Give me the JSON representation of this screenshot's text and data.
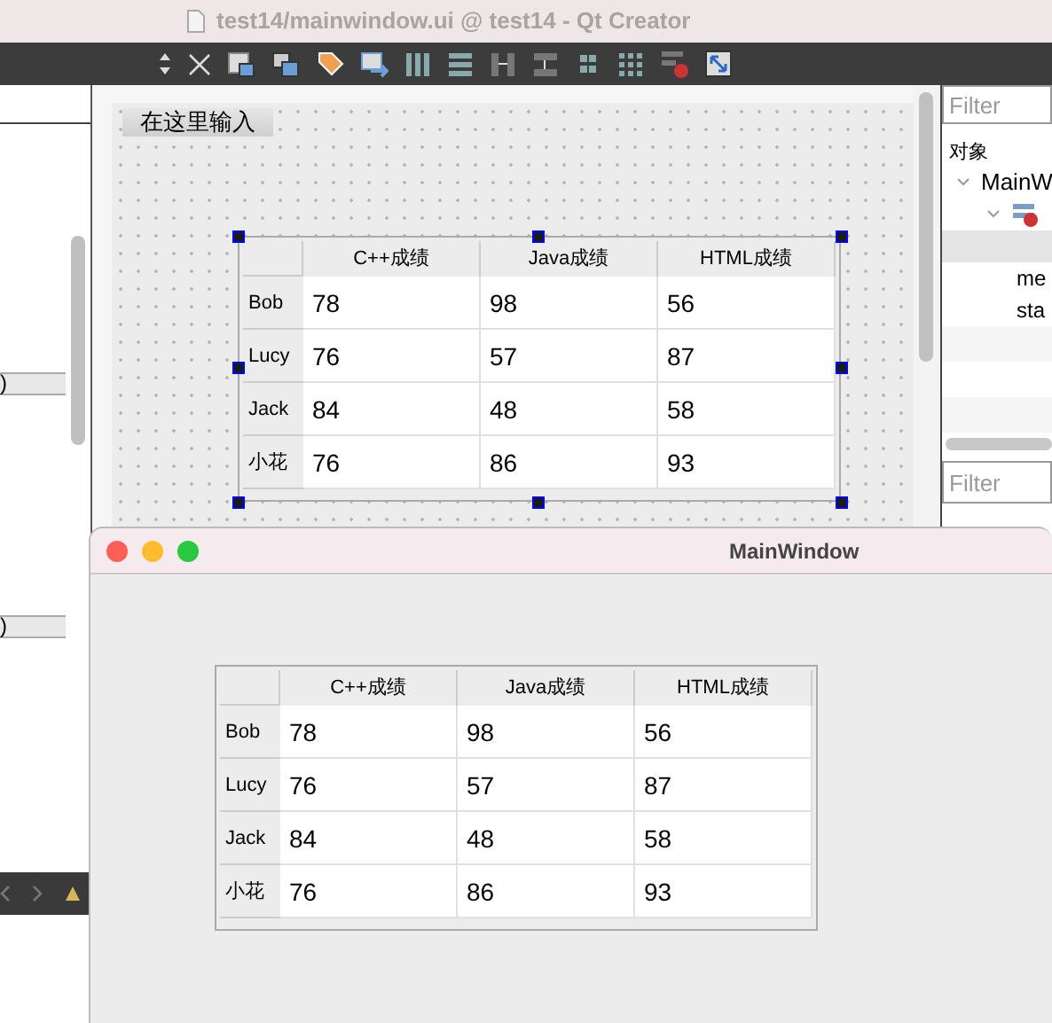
{
  "designer": {
    "window_title": "test14/mainwindow.ui @ test14 - Qt Creator",
    "left_panel": {
      "rows": [
        ")",
        ")"
      ]
    },
    "menu_placeholder": "在这里输入",
    "table": {
      "columns": [
        "C++成绩",
        "Java成绩",
        "HTML成绩"
      ],
      "rows": [
        {
          "header": "Bob",
          "cells": [
            "78",
            "98",
            "56"
          ]
        },
        {
          "header": "Lucy",
          "cells": [
            "76",
            "57",
            "87"
          ]
        },
        {
          "header": "Jack",
          "cells": [
            "84",
            "48",
            "58"
          ]
        },
        {
          "header": "小花",
          "cells": [
            "76",
            "86",
            "93"
          ]
        }
      ]
    },
    "object_inspector": {
      "filter_placeholder": "Filter",
      "heading": "对象",
      "tree": [
        {
          "label": "MainW",
          "expanded": true,
          "children": [
            {
              "expanded": true,
              "children": [
                {
                  "selected": true
                },
                {
                  "label": "me",
                  "selected": false
                },
                {
                  "label": "sta",
                  "selected": false
                }
              ]
            }
          ]
        }
      ]
    },
    "property_editor": {
      "filter_placeholder": "Filter"
    }
  },
  "preview": {
    "title": "MainWindow",
    "table": {
      "columns": [
        "C++成绩",
        "Java成绩",
        "HTML成绩"
      ],
      "rows": [
        {
          "header": "Bob",
          "cells": [
            "78",
            "98",
            "56"
          ]
        },
        {
          "header": "Lucy",
          "cells": [
            "76",
            "57",
            "87"
          ]
        },
        {
          "header": "Jack",
          "cells": [
            "84",
            "48",
            "58"
          ]
        },
        {
          "header": "小花",
          "cells": [
            "76",
            "86",
            "93"
          ]
        }
      ]
    }
  }
}
